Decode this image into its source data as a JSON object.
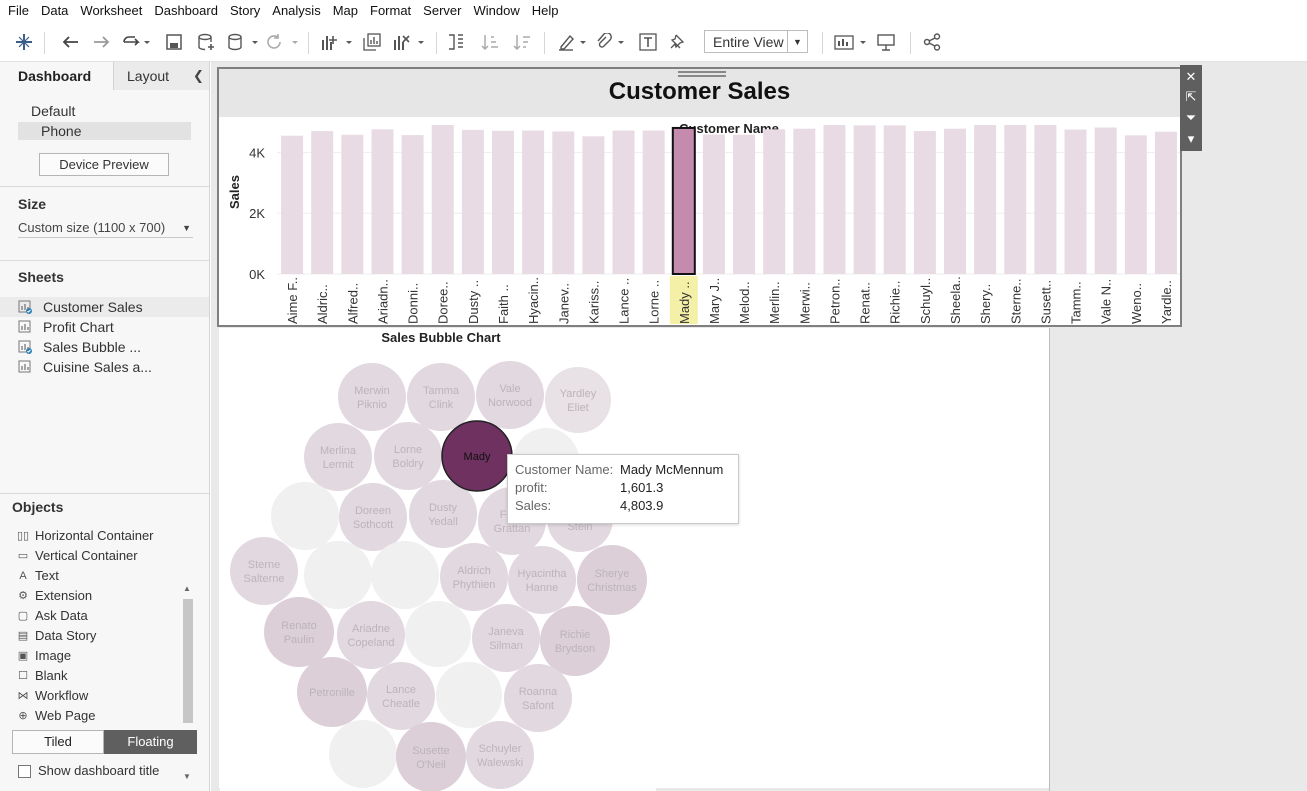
{
  "menu": [
    "File",
    "Data",
    "Worksheet",
    "Dashboard",
    "Story",
    "Analysis",
    "Map",
    "Format",
    "Server",
    "Window",
    "Help"
  ],
  "toolbar": {
    "view_mode": "Entire View"
  },
  "left_panel": {
    "tab_dashboard": "Dashboard",
    "tab_layout": "Layout",
    "devices": {
      "default": "Default",
      "phone": "Phone"
    },
    "device_preview": "Device Preview",
    "size_heading": "Size",
    "size_value": "Custom size (1100 x 700)",
    "sheets_heading": "Sheets",
    "sheets": [
      {
        "label": "Customer Sales",
        "in_use": true
      },
      {
        "label": "Profit Chart",
        "in_use": false
      },
      {
        "label": "Sales Bubble ...",
        "in_use": true
      },
      {
        "label": "Cuisine Sales a...",
        "in_use": false
      }
    ],
    "objects_heading": "Objects",
    "objects": [
      {
        "label": "Horizontal Container",
        "icon": "horizontal-container-icon",
        "glyph": "▯▯"
      },
      {
        "label": "Vertical Container",
        "icon": "vertical-container-icon",
        "glyph": "▭"
      },
      {
        "label": "Text",
        "icon": "text-icon",
        "glyph": "A"
      },
      {
        "label": "Extension",
        "icon": "extension-icon",
        "glyph": "⚙"
      },
      {
        "label": "Ask Data",
        "icon": "ask-data-icon",
        "glyph": "▢"
      },
      {
        "label": "Data Story",
        "icon": "data-story-icon",
        "glyph": "▤"
      },
      {
        "label": "Image",
        "icon": "image-icon",
        "glyph": "▣"
      },
      {
        "label": "Blank",
        "icon": "blank-icon",
        "glyph": "☐"
      },
      {
        "label": "Workflow",
        "icon": "workflow-icon",
        "glyph": "⋈"
      },
      {
        "label": "Web Page",
        "icon": "web-page-icon",
        "glyph": "⊕"
      }
    ],
    "layout_tiled": "Tiled",
    "layout_floating": "Floating",
    "show_dashboard_title": "Show dashboard title"
  },
  "dashboard": {
    "title": "Customer Sales",
    "bubble_title": "Sales Bubble Chart"
  },
  "chart_data": {
    "type": "bar",
    "title": "Customer Sales",
    "column_header": "Customer Name",
    "ylabel": "Sales",
    "ylim": [
      0,
      5000
    ],
    "yticks": [
      "0K",
      "2K",
      "4K"
    ],
    "categories": [
      "Aime F..",
      "Aldric..",
      "Alfred..",
      "Ariadn..",
      "Donni..",
      "Doree..",
      "Dusty ..",
      "Faith ..",
      "Hyacin..",
      "Janev..",
      "Kariss..",
      "Lance ..",
      "Lorne ..",
      "Mady ..",
      "Mary J..",
      "Melod..",
      "Merlin..",
      "Merwi..",
      "Petron..",
      "Renat..",
      "Richie..",
      "Schuyl..",
      "Sheela..",
      "Shery..",
      "Sterne..",
      "Susett..",
      "Tamm..",
      "Vale N..",
      "Weno..",
      "Yardle.."
    ],
    "values": [
      4550,
      4700,
      4580,
      4760,
      4570,
      4900,
      4740,
      4710,
      4720,
      4690,
      4530,
      4720,
      4720,
      4804,
      4590,
      4580,
      4760,
      4780,
      4900,
      4890,
      4890,
      4700,
      4780,
      4900,
      4900,
      4900,
      4750,
      4820,
      4560,
      4680
    ],
    "selected": "Mady .."
  },
  "bubbles": [
    {
      "label": "Merwin\nPiknio",
      "cx": 152,
      "cy": 38,
      "r": 34,
      "tone": "mid"
    },
    {
      "label": "Tamma\nClink",
      "cx": 221,
      "cy": 38,
      "r": 34,
      "tone": "mid"
    },
    {
      "label": "Vale\nNorwood",
      "cx": 290,
      "cy": 36,
      "r": 34,
      "tone": "mid"
    },
    {
      "label": "Yardley\nEliet",
      "cx": 358,
      "cy": 41,
      "r": 33,
      "tone": "light"
    },
    {
      "label": "Merlina\nLermit",
      "cx": 118,
      "cy": 98,
      "r": 34,
      "tone": "mid"
    },
    {
      "label": "Lorne\nBoldry",
      "cx": 188,
      "cy": 97,
      "r": 34,
      "tone": "mid"
    },
    {
      "label": "",
      "cx": 326,
      "cy": 102,
      "r": 33,
      "tone": "pale"
    },
    {
      "label": "",
      "cx": 85,
      "cy": 157,
      "r": 34,
      "tone": "pale"
    },
    {
      "label": "Doreen\nSothcott",
      "cx": 153,
      "cy": 158,
      "r": 34,
      "tone": "mid"
    },
    {
      "label": "Dusty\nYedall",
      "cx": 223,
      "cy": 155,
      "r": 34,
      "tone": "mid"
    },
    {
      "label": "Faith\nGrattan",
      "cx": 292,
      "cy": 162,
      "r": 34,
      "tone": "mid"
    },
    {
      "label": "Sean\nStein",
      "cx": 360,
      "cy": 160,
      "r": 33,
      "tone": "mid"
    },
    {
      "label": "Sterne\nSalterne",
      "cx": 44,
      "cy": 212,
      "r": 34,
      "tone": "mid"
    },
    {
      "label": "",
      "cx": 118,
      "cy": 216,
      "r": 34,
      "tone": "pale"
    },
    {
      "label": "",
      "cx": 185,
      "cy": 216,
      "r": 34,
      "tone": "pale"
    },
    {
      "label": "Aldrich\nPhythien",
      "cx": 254,
      "cy": 218,
      "r": 34,
      "tone": "mid"
    },
    {
      "label": "Hyacintha\nHanne",
      "cx": 322,
      "cy": 221,
      "r": 34,
      "tone": "mid"
    },
    {
      "label": "Sherye\nChristmas",
      "cx": 392,
      "cy": 221,
      "r": 35,
      "tone": "dark"
    },
    {
      "label": "Renato\nPaulin",
      "cx": 79,
      "cy": 273,
      "r": 35,
      "tone": "dark"
    },
    {
      "label": "Ariadne\nCopeland",
      "cx": 151,
      "cy": 276,
      "r": 34,
      "tone": "mid"
    },
    {
      "label": "",
      "cx": 218,
      "cy": 275,
      "r": 33,
      "tone": "pale"
    },
    {
      "label": "Janeva\nSilman",
      "cx": 286,
      "cy": 279,
      "r": 34,
      "tone": "mid"
    },
    {
      "label": "Richie\nBrydson",
      "cx": 355,
      "cy": 282,
      "r": 35,
      "tone": "dark"
    },
    {
      "label": "Petronille",
      "cx": 112,
      "cy": 333,
      "r": 35,
      "tone": "dark"
    },
    {
      "label": "Lance\nCheatle",
      "cx": 181,
      "cy": 337,
      "r": 34,
      "tone": "mid"
    },
    {
      "label": "",
      "cx": 249,
      "cy": 336,
      "r": 33,
      "tone": "pale"
    },
    {
      "label": "Roanna\nSafont",
      "cx": 318,
      "cy": 339,
      "r": 34,
      "tone": "mid"
    },
    {
      "label": "",
      "cx": 143,
      "cy": 395,
      "r": 34,
      "tone": "pale"
    },
    {
      "label": "Susette\nO'Neil",
      "cx": 211,
      "cy": 398,
      "r": 35,
      "tone": "dark"
    },
    {
      "label": "Schuyler\nWalewski",
      "cx": 280,
      "cy": 396,
      "r": 34,
      "tone": "mid"
    },
    {
      "label": "Mady",
      "cx": 257,
      "cy": 97,
      "r": 35,
      "tone": "selected"
    }
  ],
  "tooltip": {
    "name_key": "Customer Name:",
    "name_val": "Mady McMennum",
    "profit_key": "profit:",
    "profit_val": "1,601.3",
    "sales_key": "Sales:",
    "sales_val": "4,803.9"
  },
  "colors": {
    "bar_base": "#e8dbe3",
    "bar_selected": "#c48baf",
    "bubble_selected": "#6e3160",
    "highlight_label": "#f5f0a8"
  }
}
